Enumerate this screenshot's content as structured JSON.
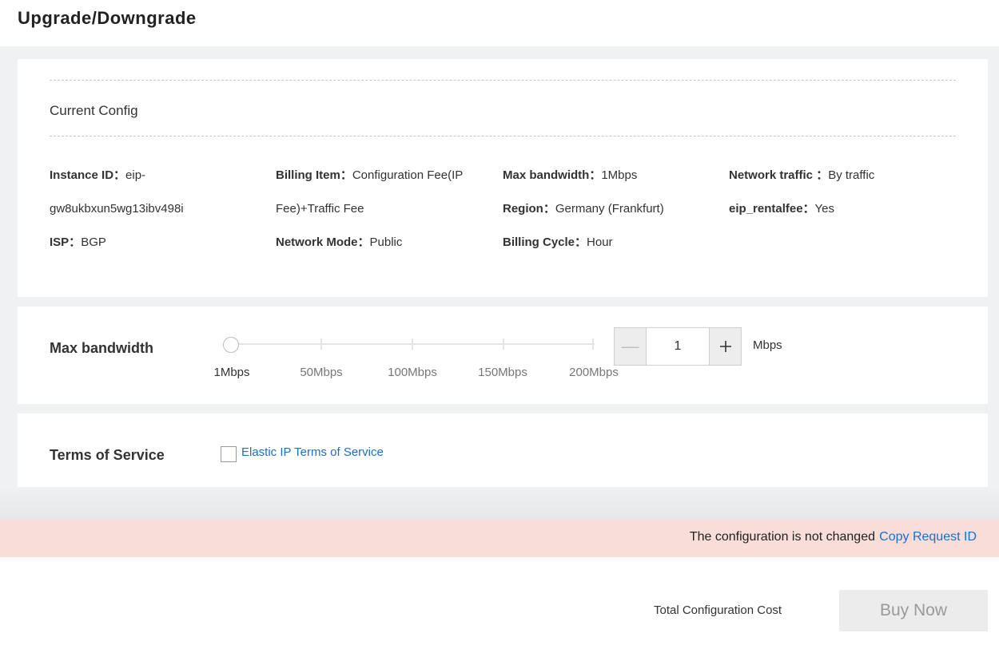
{
  "page": {
    "title": "Upgrade/Downgrade"
  },
  "current_config": {
    "title": "Current Config",
    "instance_id": {
      "label": "Instance ID：",
      "value_line1": "eip-",
      "value_line2": "gw8ukbxun5wg13ibv498i"
    },
    "billing_item": {
      "label": "Billing Item：",
      "value_line1": "Configuration Fee(IP",
      "value_line2": "Fee)+Traffic Fee"
    },
    "max_bandwidth": {
      "label": "Max bandwidth：",
      "value": "1Mbps"
    },
    "network_traffic": {
      "label": "Network traffic ：",
      "value": "By traffic"
    },
    "region": {
      "label": "Region：",
      "value": "Germany (Frankfurt)"
    },
    "eip_rentalfee": {
      "label": "eip_rentalfee：",
      "value": "Yes"
    },
    "isp": {
      "label": "ISP：",
      "value": "BGP"
    },
    "network_mode": {
      "label": "Network Mode：",
      "value": "Public"
    },
    "billing_cycle": {
      "label": "Billing Cycle：",
      "value": "Hour"
    }
  },
  "bandwidth": {
    "label": "Max bandwidth",
    "ticks": [
      "1Mbps",
      "50Mbps",
      "100Mbps",
      "150Mbps",
      "200Mbps"
    ],
    "value": "1",
    "unit": "Mbps",
    "minus_icon": "minus-icon",
    "plus_icon": "plus-icon"
  },
  "terms": {
    "label": "Terms of Service",
    "link": "Elastic IP Terms of Service",
    "checked": false
  },
  "alert": {
    "message": "The configuration is not changed",
    "copy_link": "Copy Request ID"
  },
  "footer": {
    "total_label": "Total Configuration Cost",
    "buy_button": "Buy Now"
  }
}
